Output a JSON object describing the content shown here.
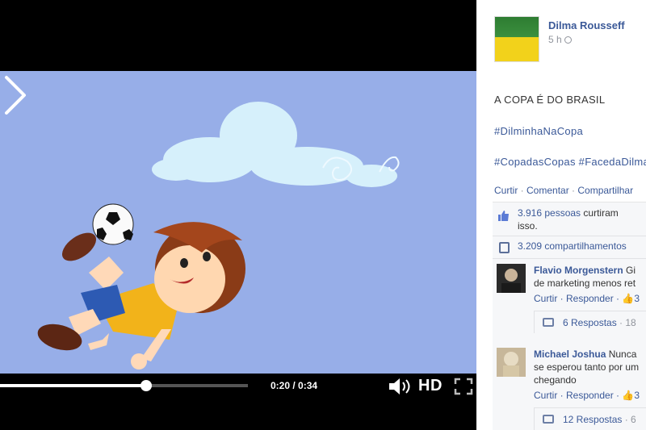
{
  "video": {
    "current_time": "0:20",
    "duration": "0:34",
    "time_display": "0:20 / 0:34",
    "progress": 0.588,
    "hd_label": "HD",
    "colors": {
      "sky": "#97aee8",
      "controls": "#000000"
    },
    "icons": [
      "next-arrow-icon",
      "volume-icon",
      "fullscreen-icon"
    ]
  },
  "post": {
    "author": "Dilma Rousseff",
    "time": "5 h",
    "text": "A COPA É DO BRASIL",
    "hashtag1": "#DilminhaNaCopa",
    "hashtags2": "#CopadasCopas #FacedaDilma",
    "actions": {
      "like": "Curtir",
      "comment": "Comentar",
      "share": "Compartilhar",
      "separator": " · "
    }
  },
  "feedback": {
    "likes_count": "3.916 pessoas",
    "likes_suffix": " curtiram",
    "likes_line2": "isso.",
    "shares": "3.209 compartilhamentos"
  },
  "comments": [
    {
      "author": "Flavio Morgenstern",
      "text_first": "Gi",
      "text_line2": "de marketing menos ret",
      "meta": "Curtir · Responder · ",
      "likes": "3",
      "replies": "6 Respostas",
      "replies_suffix": " · 18"
    },
    {
      "author": "Michael Joshua",
      "text_first": "Nunca",
      "text_line2": "se esperou tanto por um",
      "text_line3": "chegando",
      "meta": "Curtir · Responder · ",
      "likes": "3",
      "replies": "12 Respostas",
      "replies_suffix": " · 6"
    }
  ]
}
